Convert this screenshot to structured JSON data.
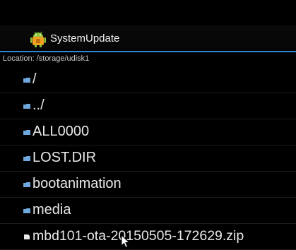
{
  "app": {
    "title": "SystemUpdate",
    "icon": "android-icon"
  },
  "location": {
    "text": "Location: /storage/udisk1"
  },
  "files": [
    {
      "name": "/",
      "type": "folder"
    },
    {
      "name": "../",
      "type": "folder"
    },
    {
      "name": "ALL0000",
      "type": "folder"
    },
    {
      "name": "LOST.DIR",
      "type": "folder"
    },
    {
      "name": "bootanimation",
      "type": "folder"
    },
    {
      "name": "media",
      "type": "folder"
    },
    {
      "name": "mbd101-ota-20150505-172629.zip",
      "type": "file"
    }
  ],
  "colors": {
    "accent": "#2e8ad8",
    "folder_icon": "#6fa8dc",
    "file_icon": "#e8e8e8",
    "background": "#000000"
  }
}
